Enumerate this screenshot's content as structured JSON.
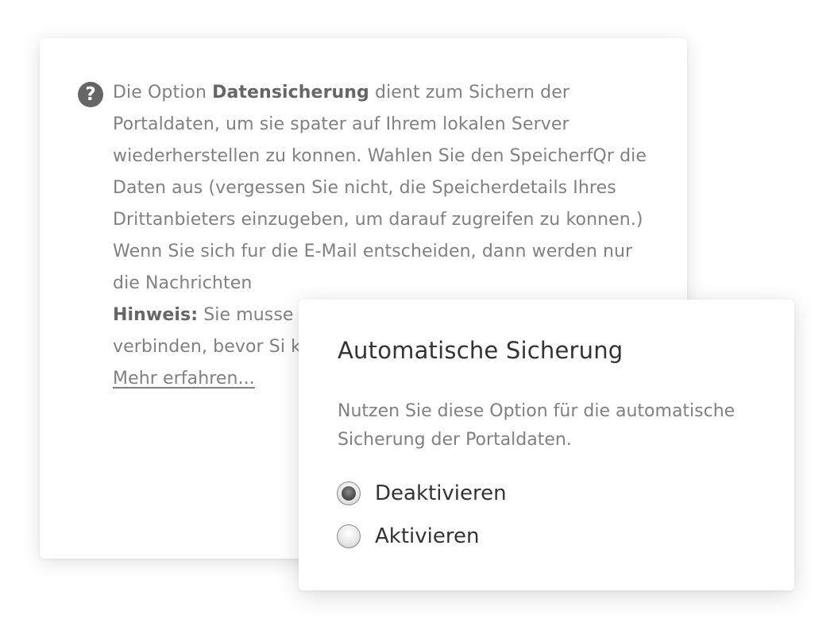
{
  "help_panel": {
    "icon": "question-circle-icon",
    "icon_glyph": "?",
    "line1_prefix": "Die Option ",
    "line1_bold": "Datensicherung",
    "line1_suffix": " dient zum Sichern der Portaldaten, um sie spater auf Ihrem lokalen Server wiederherstellen zu konnen. Wahlen Sie den SpeicherfQr die Daten aus (vergessen Sie nicht, die Speicherdetails Ihres Drittanbieters einzugeben, um darauf zugreifen zu konnen.)",
    "paragraph2": "Wenn Sie sich fur die E-Mail entscheiden, dann werden nur die Nachrichten",
    "note_bold": "Hinweis:",
    "note_text": " Sie musse Box.com, OneDrive Ordner ONLYOFFIC verbinden, bevor Si konnen.",
    "learn_more": "Mehr erfahren..."
  },
  "auto_backup": {
    "title": "Automatische Sicherung",
    "description": "Nutzen Sie diese Option für die automatische Sicherung der Portaldaten.",
    "options": [
      {
        "label": "Deaktivieren",
        "selected": true
      },
      {
        "label": "Aktivieren",
        "selected": false
      }
    ]
  }
}
